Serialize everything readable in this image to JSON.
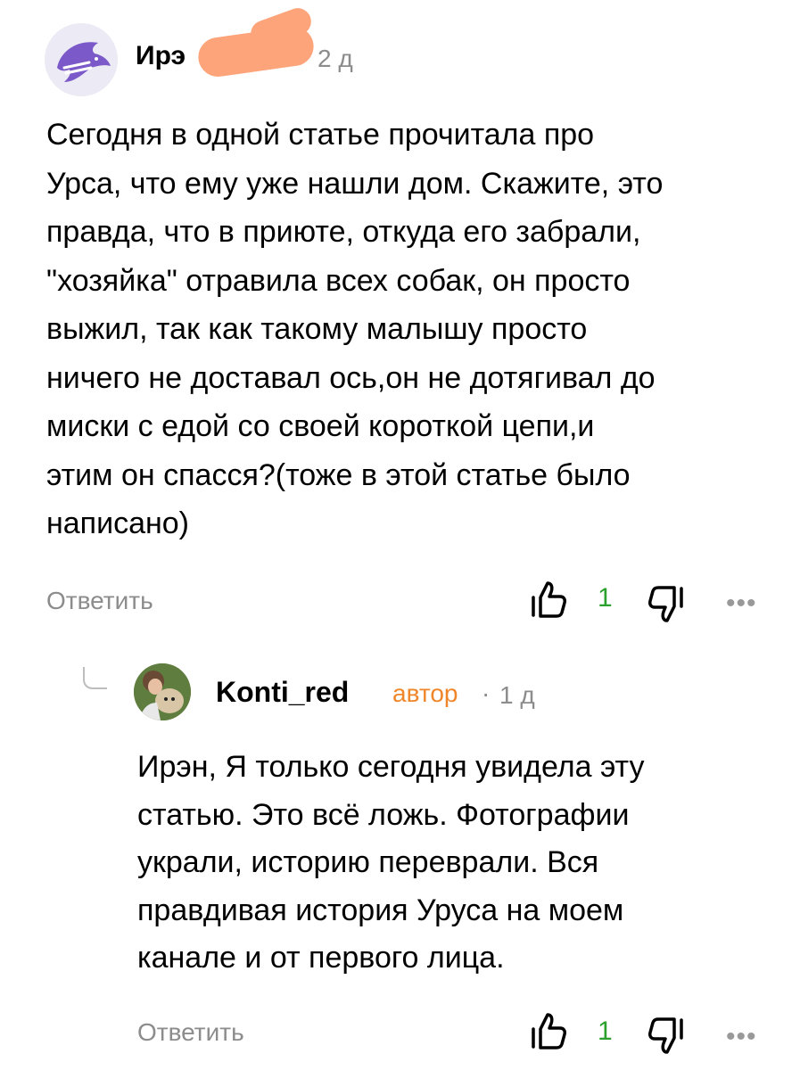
{
  "comment": {
    "author_name": "Ирэ",
    "time": "2 д",
    "text_lines": [
      "Сегодня в одной статье прочитала про",
      "Урса, что ему уже нашли дом. Скажите, это",
      "правда, что в приюте, откуда его забрали,",
      "\"хозяйка\" отравила всех собак, он просто",
      "выжил, так как такому малышу просто",
      "ничего не доставал ось,он не дотягивал до",
      "миски с едой со своей короткой цепи,и",
      "этим он спасся?(тоже в этой статье было",
      "написано)"
    ],
    "reply_label": "Ответить",
    "like_count": "1",
    "more_label": "•••"
  },
  "reply": {
    "author_name": "Konti_red",
    "badge": "автор",
    "separator": "·",
    "time": "1 д",
    "text_lines": [
      "Ирэн, Я только сегодня увидела эту",
      "статью. Это всё ложь. Фотографии",
      "украли, историю переврали. Вся",
      "правдивая история Уруса на моем",
      "канале и от первого лица."
    ],
    "reply_label": "Ответить",
    "like_count": "1",
    "more_label": "•••"
  },
  "colors": {
    "like_count": "#2ca02c",
    "author_badge": "#f0862a",
    "meta_gray": "#8c8c8c",
    "avatar_purple": "#7b59c9",
    "redaction": "#fda47a"
  },
  "icons": {
    "comment_avatar": "dolphin-avatar-icon",
    "like": "thumbs-up-icon",
    "dislike": "thumbs-down-icon",
    "reply_connector": "reply-connector-icon"
  }
}
